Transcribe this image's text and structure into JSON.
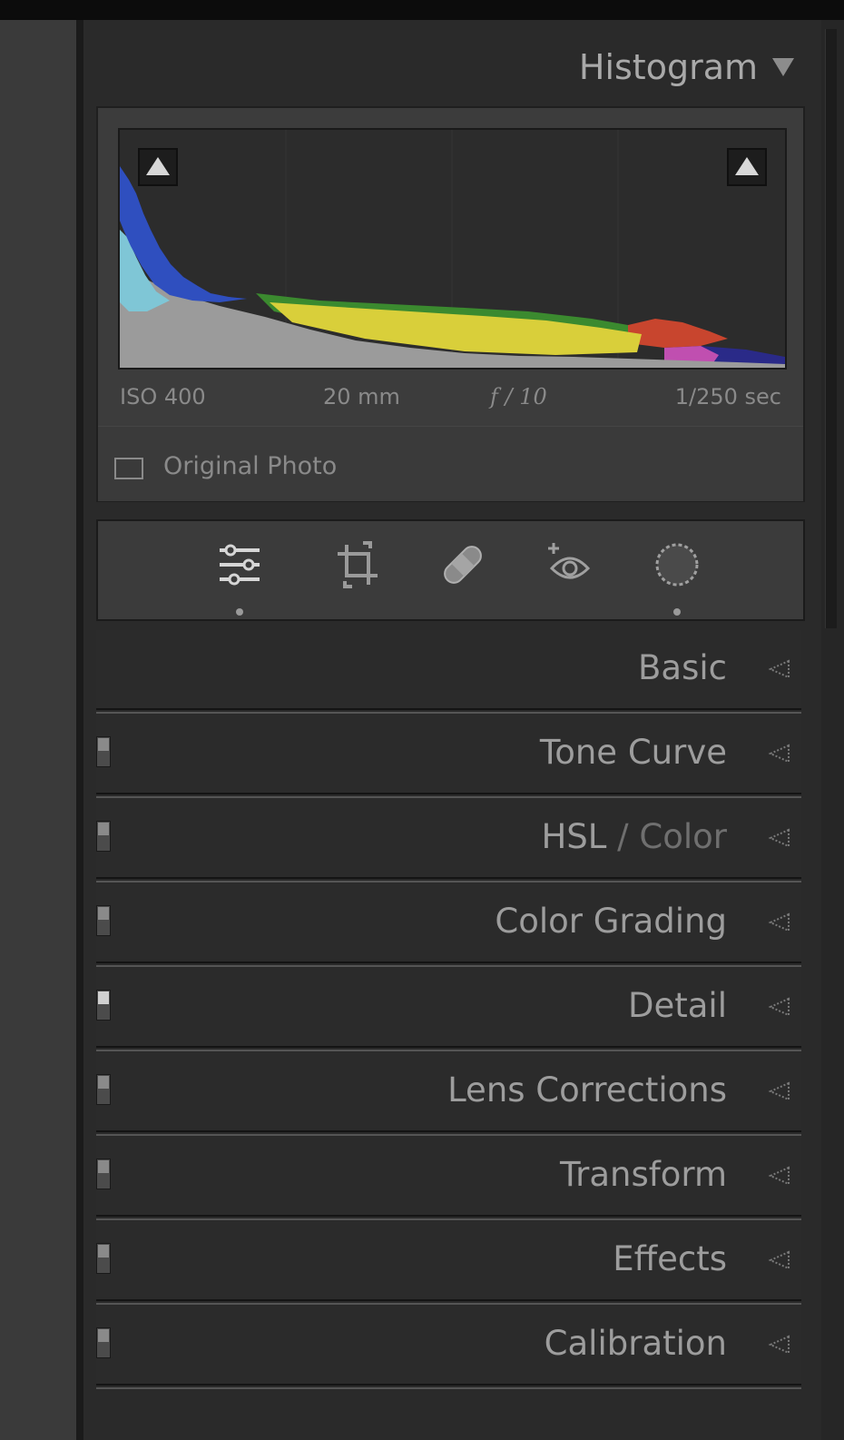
{
  "histogram": {
    "title": "Histogram",
    "exif": {
      "iso": "ISO 400",
      "focal_length": "20 mm",
      "aperture": "f / 10",
      "shutter": "1/250 sec"
    },
    "original_photo_label": "Original Photo",
    "original_photo_checked": false
  },
  "tools": [
    {
      "name": "edit",
      "icon": "sliders-icon",
      "active": true
    },
    {
      "name": "crop",
      "icon": "crop-icon",
      "active": false
    },
    {
      "name": "healing",
      "icon": "bandage-icon",
      "active": false
    },
    {
      "name": "red-eye",
      "icon": "red-eye-icon",
      "active": false
    },
    {
      "name": "masking",
      "icon": "masking-circle-icon",
      "active": false
    }
  ],
  "sections": [
    {
      "label": "Basic",
      "has_switch": false
    },
    {
      "label": "Tone Curve",
      "has_switch": true
    },
    {
      "label_main": "HSL",
      "label_dim": " / Color",
      "has_switch": true
    },
    {
      "label": "Color Grading",
      "has_switch": true
    },
    {
      "label": "Detail",
      "has_switch": true
    },
    {
      "label": "Lens Corrections",
      "has_switch": true
    },
    {
      "label": "Transform",
      "has_switch": true
    },
    {
      "label": "Effects",
      "has_switch": true
    },
    {
      "label": "Calibration",
      "has_switch": true
    }
  ],
  "colors": {
    "panel_bg": "#2a2a2a",
    "histogram_blue": "#2f4fbf",
    "histogram_yellow": "#d9cf3a",
    "histogram_gray": "#9b9b9b"
  }
}
